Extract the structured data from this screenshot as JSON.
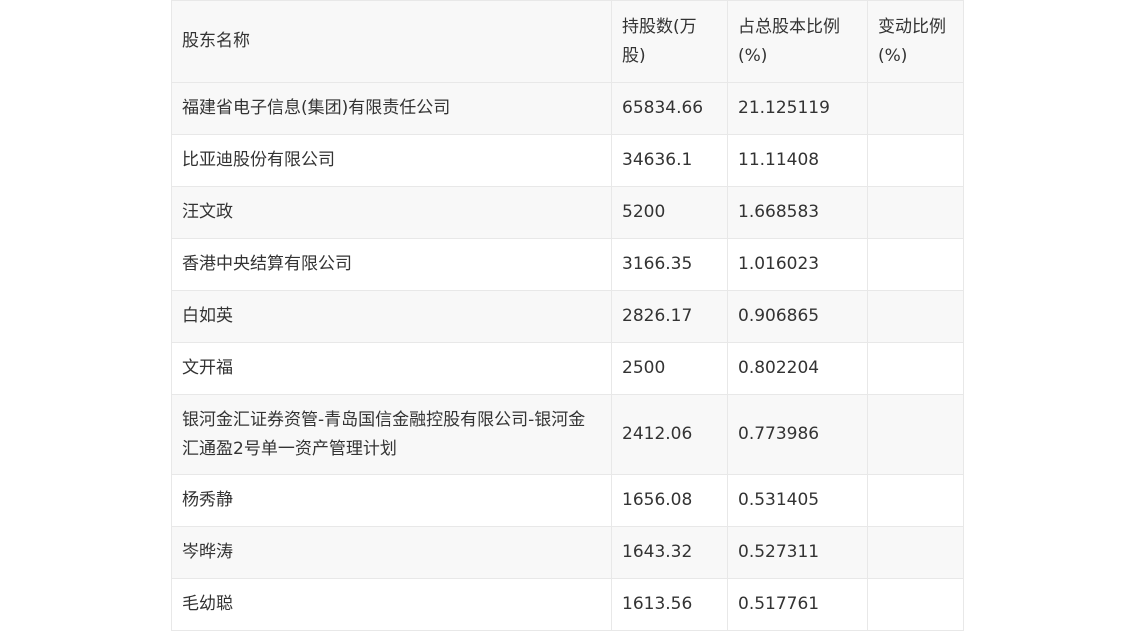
{
  "table": {
    "headers": [
      "股东名称",
      "持股数(万股)",
      "占总股本比例(%)",
      "变动比例(%)"
    ],
    "rows": [
      {
        "name": "福建省电子信息(集团)有限责任公司",
        "shares": "65834.66",
        "ratio": "21.125119",
        "change": ""
      },
      {
        "name": "比亚迪股份有限公司",
        "shares": "34636.1",
        "ratio": "11.11408",
        "change": ""
      },
      {
        "name": "汪文政",
        "shares": "5200",
        "ratio": "1.668583",
        "change": ""
      },
      {
        "name": "香港中央结算有限公司",
        "shares": "3166.35",
        "ratio": "1.016023",
        "change": ""
      },
      {
        "name": "白如英",
        "shares": "2826.17",
        "ratio": "0.906865",
        "change": ""
      },
      {
        "name": "文开福",
        "shares": "2500",
        "ratio": "0.802204",
        "change": ""
      },
      {
        "name": "银河金汇证券资管-青岛国信金融控股有限公司-银河金汇通盈2号单一资产管理计划",
        "shares": "2412.06",
        "ratio": "0.773986",
        "change": ""
      },
      {
        "name": "杨秀静",
        "shares": "1656.08",
        "ratio": "0.531405",
        "change": ""
      },
      {
        "name": "岑晔涛",
        "shares": "1643.32",
        "ratio": "0.527311",
        "change": ""
      },
      {
        "name": "毛幼聪",
        "shares": "1613.56",
        "ratio": "0.517761",
        "change": ""
      }
    ]
  }
}
